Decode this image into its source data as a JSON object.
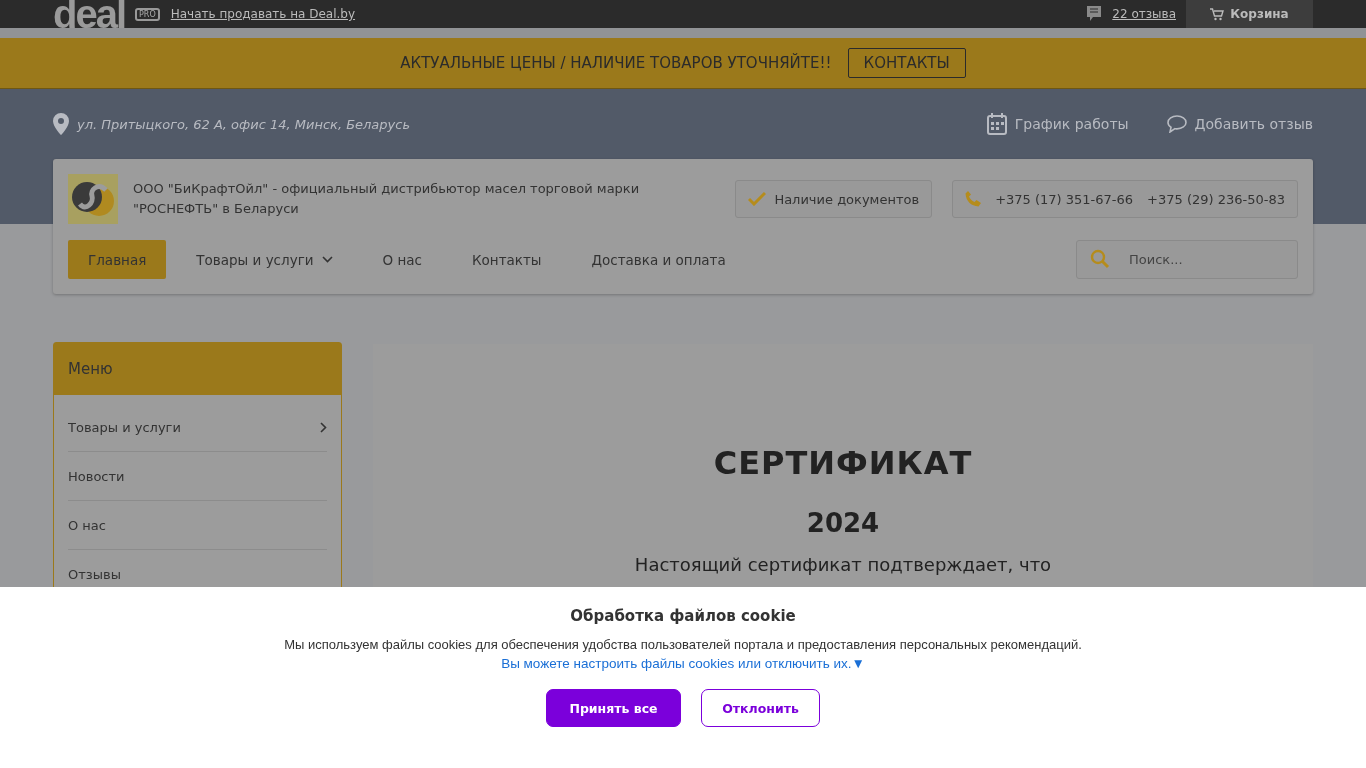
{
  "topbar": {
    "logo": "deal",
    "pro_badge": "PRO",
    "sell_link": "Начать продавать на Deal.by",
    "reviews_link": "22 отзыва",
    "cart": "Корзина"
  },
  "notice": {
    "text": "АКТУАЛЬНЫЕ ЦЕНЫ / НАЛИЧИЕ ТОВАРОВ УТОЧНЯЙТЕ!!",
    "button": "КОНТАКТЫ"
  },
  "address": "ул. Притыцкого, 62 А, офис 14, Минск, Беларусь",
  "header_links": [
    {
      "kind": "schedule",
      "label": "График работы"
    },
    {
      "kind": "review",
      "label": "Добавить отзыв"
    }
  ],
  "company": {
    "description": "ООО \"БиКрафтОйл\" - официальный дистрибьютор масел торговой марки \"РОСНЕФТЬ\" в Беларуси",
    "documents": "Наличие документов",
    "phones": [
      "+375 (17) 351-67-66",
      "+375 (29) 236-50-83"
    ]
  },
  "nav": [
    {
      "label": "Главная",
      "selected": true,
      "has_menu": false
    },
    {
      "label": "Товары и услуги",
      "selected": false,
      "has_menu": true
    },
    {
      "label": "О нас",
      "selected": false,
      "has_menu": false
    },
    {
      "label": "Контакты",
      "selected": false,
      "has_menu": false
    },
    {
      "label": "Доставка и оплата",
      "selected": false,
      "has_menu": false
    }
  ],
  "search": {
    "placeholder": "Поиск..."
  },
  "sidebar": {
    "title": "Меню",
    "items": [
      {
        "label": "Товары и услуги",
        "has_children": true
      },
      {
        "label": "Новости",
        "has_children": false
      },
      {
        "label": "О нас",
        "has_children": false
      },
      {
        "label": "Отзывы",
        "has_children": false
      }
    ]
  },
  "certificate": {
    "title": "СЕРТИФИКАТ",
    "year": "2024",
    "text": "Настоящий сертификат подтверждает, что"
  },
  "cookie": {
    "title": "Обработка файлов cookie",
    "text": "Мы используем файлы cookies для обеспечения удобства пользователей портала и предоставления персональных рекомендаций.",
    "link": "Вы можете настроить файлы cookies или отключить их.▼",
    "accept": "Принять все",
    "decline": "Отклонить"
  }
}
